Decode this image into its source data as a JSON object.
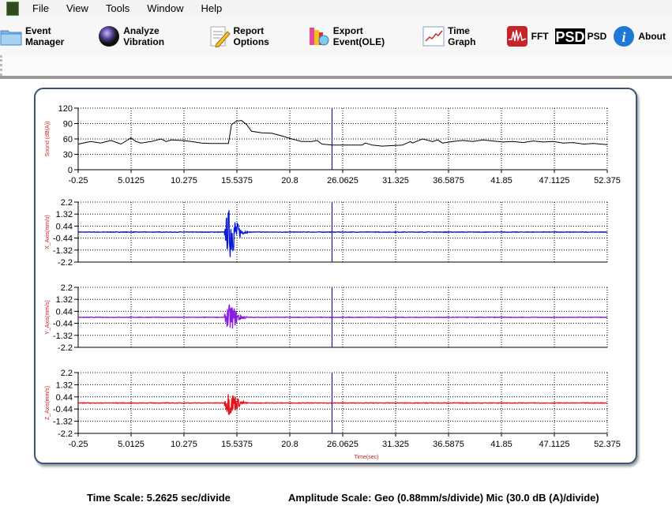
{
  "menu": [
    "File",
    "View",
    "Tools",
    "Window",
    "Help"
  ],
  "toolbar": [
    {
      "label": "Event Manager",
      "icon": "folder-icon"
    },
    {
      "label": "Analyze Vibration",
      "icon": "globe-icon"
    },
    {
      "label": "Report Options",
      "icon": "report-pencil-icon"
    },
    {
      "label": "Export Event(OLE)",
      "icon": "export-books-icon"
    },
    {
      "label": "Time Graph",
      "icon": "line-graph-icon"
    },
    {
      "label": "FFT",
      "icon": "fft-icon"
    },
    {
      "label": "PSD",
      "icon": "psd-icon"
    },
    {
      "label": "About",
      "icon": "info-icon"
    }
  ],
  "status": {
    "time_scale": "Time Scale: 5.2625 sec/divide",
    "amplitude_scale": "Amplitude Scale: Geo (0.88mm/s/divide) Mic (30.0 dB (A)/divide)"
  },
  "chart_data": [
    {
      "type": "line",
      "ylabel": "Sound (dB(A))",
      "ylim": [
        0,
        120
      ],
      "yticks": [
        "120",
        "90",
        "60",
        "30",
        "0"
      ],
      "xlim": [
        -0.25,
        52.375
      ],
      "xticks": [
        "-0.25",
        "5.0125",
        "10.275",
        "15.5375",
        "20.8",
        "26.0625",
        "31.325",
        "36.5875",
        "41.85",
        "47.1125",
        "52.375"
      ],
      "grid": true,
      "color": "#000000",
      "cursor_time": 25.0,
      "cursor_color": "#1a1a8c",
      "x": [
        -0.25,
        1,
        2,
        3,
        4,
        5,
        5.5,
        6,
        7,
        8,
        8.5,
        9,
        10,
        11,
        12,
        13,
        14,
        14.7,
        15,
        15.5,
        16,
        16.5,
        17,
        18,
        19,
        20,
        21,
        22,
        23,
        23.5,
        24,
        25,
        26,
        27,
        28,
        28.3,
        29,
        30,
        31,
        32,
        32.8,
        33,
        34,
        35,
        35.5,
        36,
        37,
        38,
        39,
        40,
        41,
        42,
        43,
        44,
        45,
        46,
        47,
        48,
        49,
        50,
        51,
        52.375
      ],
      "y": [
        50,
        55,
        52,
        57,
        50,
        62,
        55,
        52,
        55,
        60,
        55,
        58,
        57,
        55,
        52,
        51,
        51,
        51,
        88,
        95,
        96,
        88,
        75,
        72,
        71,
        66,
        60,
        55,
        55,
        57,
        50,
        48,
        48,
        48,
        48,
        52,
        48,
        46,
        47,
        48,
        55,
        52,
        60,
        55,
        58,
        52,
        55,
        57,
        55,
        58,
        56,
        54,
        55,
        53,
        56,
        54,
        55,
        52,
        53,
        50,
        51,
        49
      ]
    },
    {
      "type": "line",
      "ylabel": "X_Axis(mm/s)",
      "ylim": [
        -2.2,
        2.2
      ],
      "yticks": [
        "2.2",
        "1.32",
        "0.44",
        "-0.44",
        "-1.32",
        "-2.2"
      ],
      "xlim": [
        -0.25,
        52.375
      ],
      "grid": true,
      "color": "#0b18d6",
      "cursor_time": 25.0,
      "envelope_t": [
        14.3,
        14.6,
        14.9,
        15.2,
        15.6,
        16.0,
        16.6
      ],
      "envelope_amp": [
        0.3,
        1.5,
        2.0,
        1.4,
        0.7,
        0.2,
        0.05
      ]
    },
    {
      "type": "line",
      "ylabel": "Y_Axis(mm/s)",
      "ylim": [
        -2.2,
        2.2
      ],
      "yticks": [
        "2.2",
        "1.32",
        "0.44",
        "-0.44",
        "-1.32",
        "-2.2"
      ],
      "xlim": [
        -0.25,
        52.375
      ],
      "grid": true,
      "color": "#8a1ee0",
      "cursor_time": 25.0,
      "envelope_t": [
        14.3,
        14.6,
        14.9,
        15.2,
        15.6,
        16.0,
        16.6
      ],
      "envelope_amp": [
        0.2,
        0.8,
        1.0,
        0.8,
        0.4,
        0.15,
        0.04
      ]
    },
    {
      "type": "line",
      "ylabel": "Z_Axis(mm/s)",
      "xlabel": "Time(sec)",
      "ylim": [
        -2.2,
        2.2
      ],
      "yticks": [
        "2.2",
        "1.32",
        "0.44",
        "-0.44",
        "-1.32",
        "-2.2"
      ],
      "xlim": [
        -0.25,
        52.375
      ],
      "xticks": [
        "-0.25",
        "5.0125",
        "10.275",
        "15.5375",
        "20.8",
        "26.0625",
        "31.325",
        "36.5875",
        "41.85",
        "47.1125",
        "52.375"
      ],
      "grid": true,
      "color": "#e3141b",
      "cursor_time": 25.0,
      "envelope_t": [
        14.3,
        14.6,
        14.9,
        15.2,
        15.6,
        16.0,
        16.6
      ],
      "envelope_amp": [
        0.2,
        0.8,
        0.9,
        0.7,
        0.4,
        0.15,
        0.04
      ]
    }
  ]
}
